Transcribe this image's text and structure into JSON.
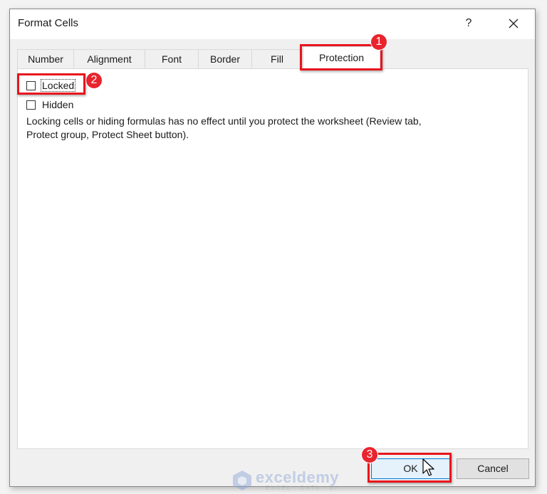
{
  "dialog": {
    "title": "Format Cells",
    "help_label": "?",
    "close_icon": "close-icon"
  },
  "tabs": [
    {
      "label": "Number",
      "selected": false
    },
    {
      "label": "Alignment",
      "selected": false
    },
    {
      "label": "Font",
      "selected": false
    },
    {
      "label": "Border",
      "selected": false
    },
    {
      "label": "Fill",
      "selected": false
    },
    {
      "label": "Protection",
      "selected": true
    }
  ],
  "protection": {
    "locked": {
      "label": "Locked",
      "checked": false
    },
    "hidden": {
      "label": "Hidden",
      "checked": false
    },
    "description_line1": "Locking cells or hiding formulas has no effect until you protect the worksheet (Review tab,",
    "description_line2": "Protect group, Protect Sheet button)."
  },
  "buttons": {
    "ok": "OK",
    "cancel": "Cancel"
  },
  "annotations": {
    "step1": "1",
    "step2": "2",
    "step3": "3",
    "highlight_color": "#e8151d"
  },
  "watermark": {
    "name": "exceldemy",
    "tagline": "EXCEL · DATA · BI"
  }
}
